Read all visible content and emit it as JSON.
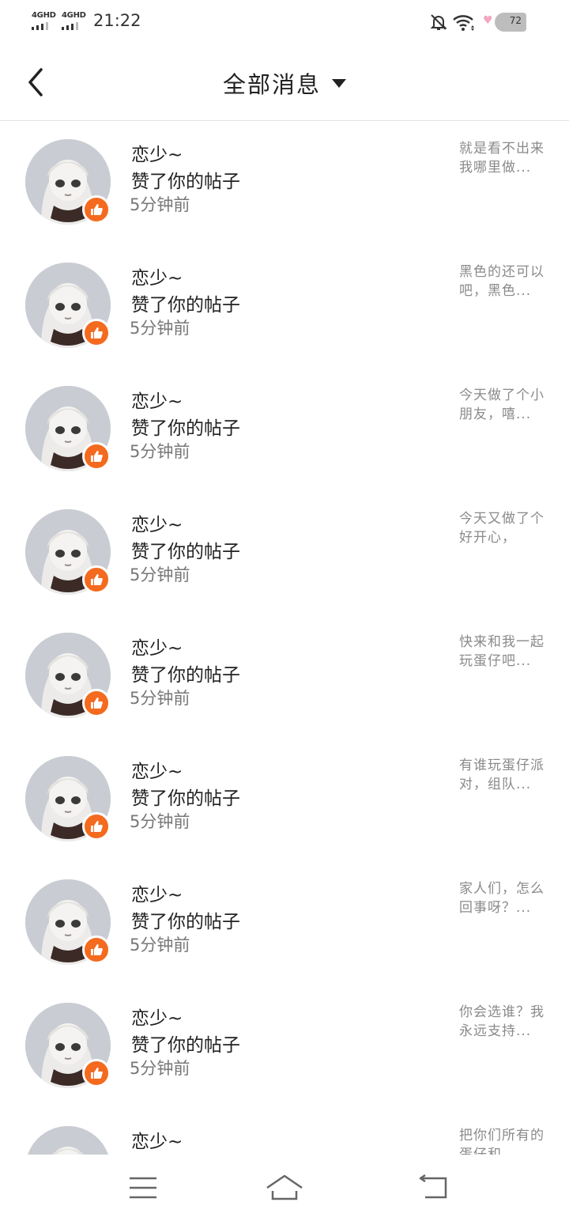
{
  "status_bar": {
    "signal_1": "4GHD",
    "signal_2": "4GHD",
    "time": "21:22",
    "battery": "72"
  },
  "header": {
    "title": "全部消息"
  },
  "messages": [
    {
      "name": "恋少~",
      "action": "赞了你的帖子",
      "time": "5分钟前",
      "preview": "就是看不出来我哪里做..."
    },
    {
      "name": "恋少~",
      "action": "赞了你的帖子",
      "time": "5分钟前",
      "preview": "黑色的还可以吧，黑色..."
    },
    {
      "name": "恋少~",
      "action": "赞了你的帖子",
      "time": "5分钟前",
      "preview": "今天做了个小朋友，嘻..."
    },
    {
      "name": "恋少~",
      "action": "赞了你的帖子",
      "time": "5分钟前",
      "preview": "今天又做了个好开心，"
    },
    {
      "name": "恋少~",
      "action": "赞了你的帖子",
      "time": "5分钟前",
      "preview": "快来和我一起玩蛋仔吧..."
    },
    {
      "name": "恋少~",
      "action": "赞了你的帖子",
      "time": "5分钟前",
      "preview": "有谁玩蛋仔派对，组队..."
    },
    {
      "name": "恋少~",
      "action": "赞了你的帖子",
      "time": "5分钟前",
      "preview": "家人们，怎么回事呀？..."
    },
    {
      "name": "恋少~",
      "action": "赞了你的帖子",
      "time": "5分钟前",
      "preview": "你会选谁？我永远支持..."
    },
    {
      "name": "恋少~",
      "action": "",
      "time": "",
      "preview": "把你们所有的蛋仔和"
    }
  ],
  "icons": {
    "back": "chevron-left-icon",
    "dropdown": "caret-down-icon",
    "like": "thumbs-up-icon",
    "menu": "menu-icon",
    "home": "home-icon",
    "return": "return-icon"
  },
  "colors": {
    "like_badge": "#f46a1e",
    "divider": "#e3e3e3",
    "muted_text": "#8a8a8a"
  }
}
